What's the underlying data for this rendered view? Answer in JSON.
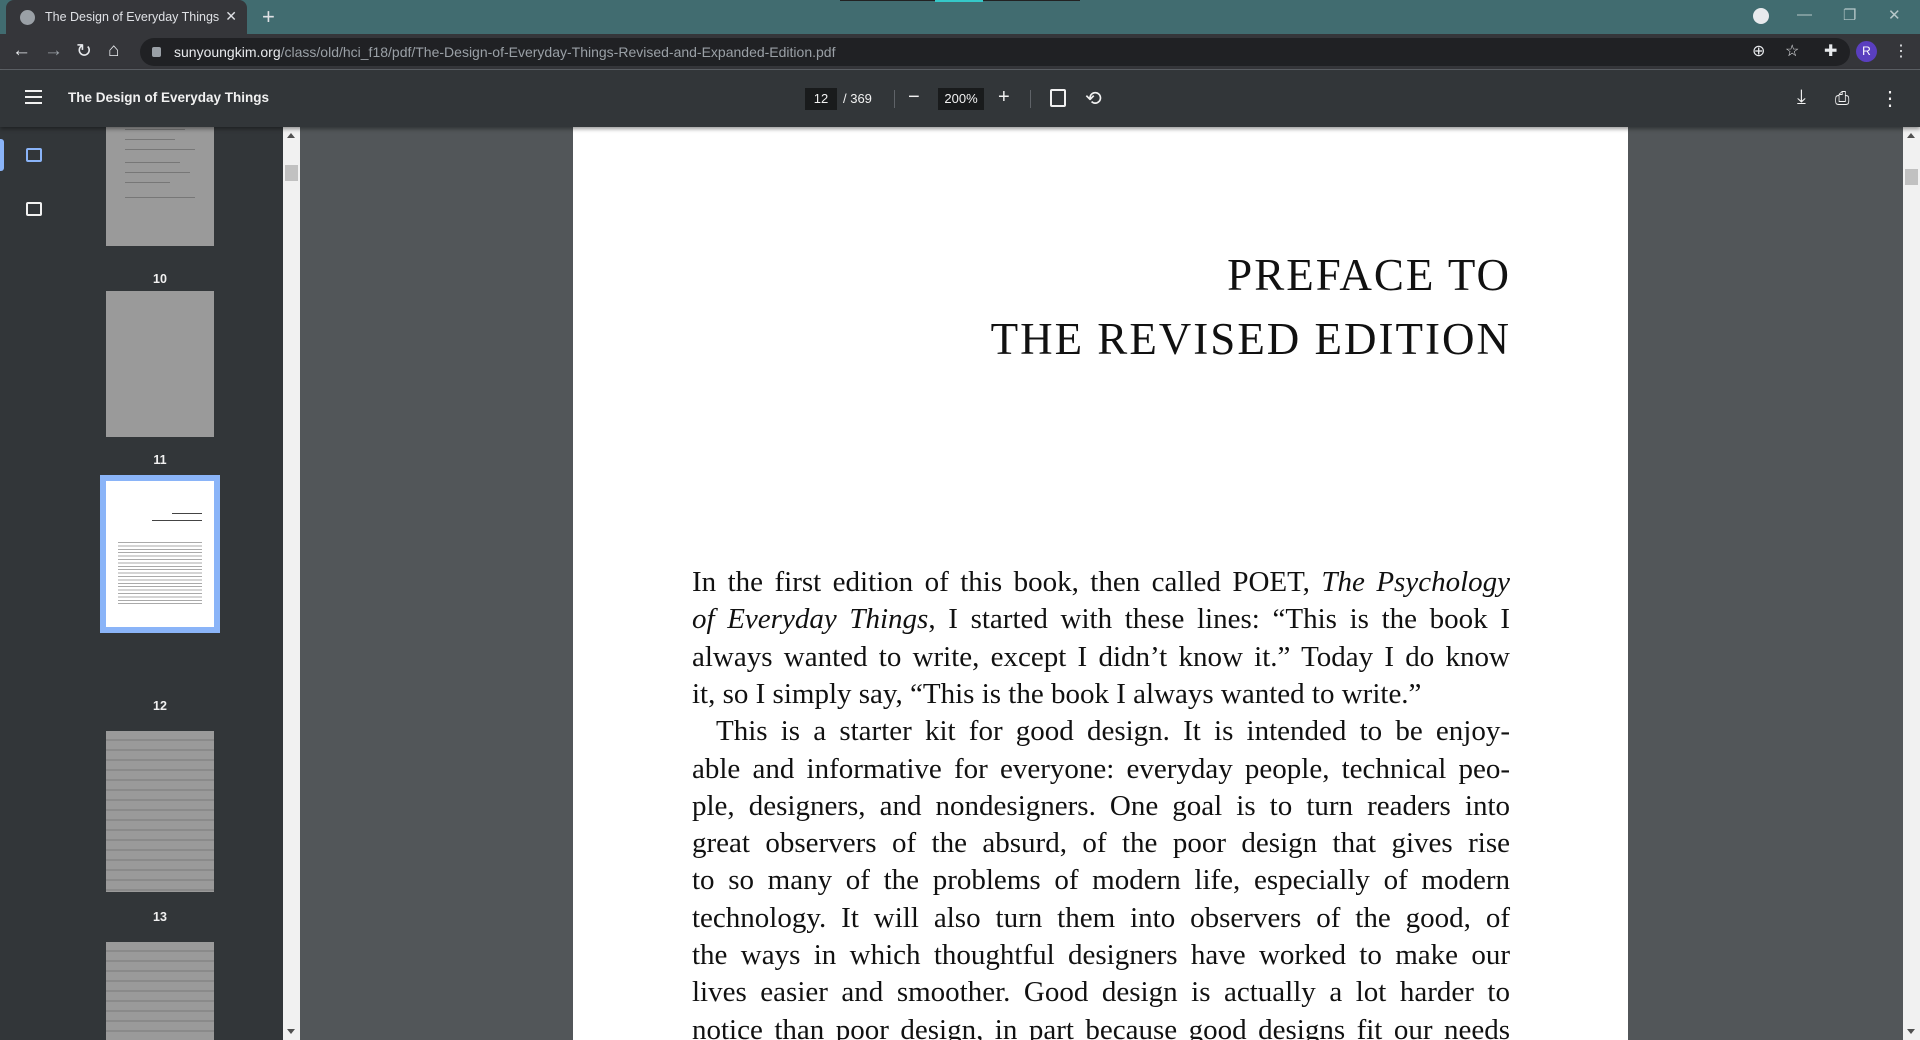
{
  "browser": {
    "tab_title": "The Design of Everyday Things",
    "url_host": "sunyoungkim.org",
    "url_path": "/class/old/hci_f18/pdf/The-Design-of-Everyday-Things-Revised-and-Expanded-Edition.pdf",
    "profile_initial": "R"
  },
  "viewer": {
    "title": "The Design of Everyday Things",
    "current_page": "12",
    "total_pages": "/ 369",
    "zoom": "200%"
  },
  "thumbnails": [
    {
      "label": "10"
    },
    {
      "label": "11"
    },
    {
      "label": "12",
      "selected": true
    },
    {
      "label": "13"
    }
  ],
  "document": {
    "heading_line1": "PREFACE TO",
    "heading_line2": "THE REVISED EDITION",
    "lines": [
      "In the first edition of this book, then called POET, The Psychology",
      "of Everyday Things, I started with these lines: “This is the book I",
      "always wanted to write, except I didn’t know it.” Today I do know",
      "it, so I simply say, “This is the book I always wanted to write.”",
      "This is a starter kit for good design. It is intended to be enjoy-",
      "able and informative for everyone: everyday people, technical peo-",
      "ple, designers, and nondesigners. One goal is to turn readers into",
      "great observers of the absurd, of the poor design that gives rise",
      "to so many of the problems of modern life, especially of modern",
      "technology. It will also turn them into observers of the good, of",
      "the ways in which thoughtful designers have worked to make our",
      "lives easier and smoother. Good design is actually a lot harder to",
      "notice than poor design, in part because good designs fit our needs"
    ]
  }
}
